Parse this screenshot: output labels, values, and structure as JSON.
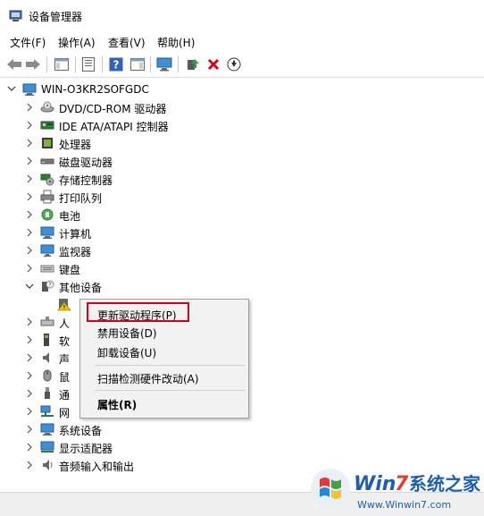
{
  "window": {
    "title": "设备管理器"
  },
  "menu": {
    "file": "文件(F)",
    "action": "操作(A)",
    "view": "查看(V)",
    "help": "帮助(H)"
  },
  "tree": {
    "root": "WIN-O3KR2SOFGDC",
    "items": [
      {
        "label": "DVD/CD-ROM 驱动器",
        "icon": "dvd-icon"
      },
      {
        "label": "IDE ATA/ATAPI 控制器",
        "icon": "ide-controller-icon"
      },
      {
        "label": "处理器",
        "icon": "processor-icon"
      },
      {
        "label": "磁盘驱动器",
        "icon": "disk-icon"
      },
      {
        "label": "存储控制器",
        "icon": "storage-controller-icon"
      },
      {
        "label": "打印队列",
        "icon": "printer-icon"
      },
      {
        "label": "电池",
        "icon": "battery-icon"
      },
      {
        "label": "计算机",
        "icon": "computer-icon"
      },
      {
        "label": "监视器",
        "icon": "monitor-icon"
      },
      {
        "label": "键盘",
        "icon": "keyboard-icon"
      },
      {
        "label": "其他设备",
        "icon": "other-devices-icon"
      }
    ],
    "partial_items": [
      {
        "label": "人",
        "icon": "hid-icon"
      },
      {
        "label": "软",
        "icon": "software-device-icon"
      },
      {
        "label": "声",
        "icon": "sound-icon"
      },
      {
        "label": "鼠",
        "icon": "mouse-icon"
      },
      {
        "label": "通",
        "icon": "usb-icon"
      },
      {
        "label": "网",
        "icon": "network-icon"
      }
    ],
    "bottom_items": [
      {
        "label": "系统设备",
        "icon": "system-devices-icon"
      },
      {
        "label": "显示适配器",
        "icon": "display-adapter-icon"
      },
      {
        "label": "音频输入和输出",
        "icon": "audio-io-icon"
      }
    ]
  },
  "context_menu": {
    "update_driver": "更新驱动程序(P)",
    "disable_device": "禁用设备(D)",
    "uninstall_device": "卸载设备(U)",
    "scan_hardware": "扫描检测硬件改动(A)",
    "properties": "属性(R)"
  },
  "colors": {
    "highlight_border": "#d9001b",
    "menu_bg": "#f2f2f2"
  }
}
